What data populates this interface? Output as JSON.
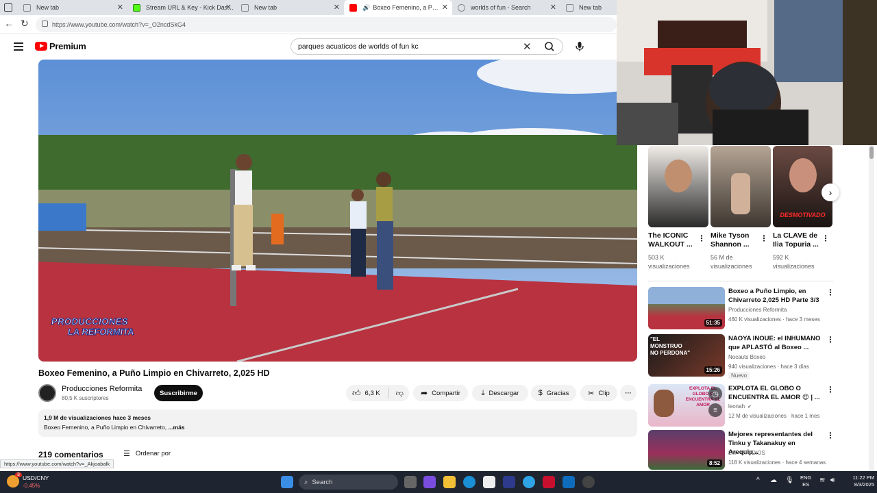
{
  "browser": {
    "tabs": [
      {
        "label": "New tab"
      },
      {
        "label": "Stream URL & Key - Kick Dashbo..."
      },
      {
        "label": "New tab"
      },
      {
        "label": "Boxeo Femenino, a Puño Lir..."
      },
      {
        "label": "worlds of fun - Search"
      },
      {
        "label": "New tab"
      }
    ],
    "url": "https://www.youtube.com/watch?v=_O2ncdSkG4",
    "status_url": "https://www.youtube.com/watch?v=_Akjoabalk"
  },
  "youtube": {
    "logo_text": "Premium",
    "search_value": "parques acuaticos de worlds of fun kc"
  },
  "video": {
    "title": "Boxeo Femenino, a Puño Limpio en Chivarreto, 2,025 HD",
    "watermark_line1": "PRODUCCIONES",
    "watermark_line2": "LA REFORMITA",
    "channel_name": "Producciones  Reformita",
    "subscribers": "80,5 K suscriptores",
    "subscribe_label": "Suscribirme",
    "likes": "6,3 K",
    "share_label": "Compartir",
    "download_label": "Descargar",
    "thanks_label": "Gracias",
    "clip_label": "Clip",
    "views_line": "1,9 M de visualizaciones  hace 3 meses",
    "description": "Boxeo Femenino, a Puño Limpio en Chivarreto, ",
    "more_label": "...más",
    "comments_count": "219 comentarios",
    "sort_label": "Ordenar por"
  },
  "shorts": [
    {
      "title": "The ICONIC WALKOUT ...",
      "views": "503 K visualizaciones"
    },
    {
      "title": "Mike Tyson Shannon ...",
      "views": "56 M de visualizaciones"
    },
    {
      "title": "La CLAVE de Ilia Topuria ...",
      "views": "592 K visualizaciones",
      "overlay": "DESMOTIVADO"
    }
  ],
  "recommended": [
    {
      "title": "Boxeo a Puño Limpio, en Chivarreto 2,025 HD Parte 3/3",
      "channel": "Producciones Reformita",
      "meta": "460 K visualizaciones · hace 3 meses",
      "duration": "51:35",
      "badge": ""
    },
    {
      "title": "NAOYA INOUE: el INHUMANO que APLASTÓ al Boxeo ...",
      "channel": "Nocauts Boxeo",
      "meta": "940 visualizaciones · hace 3 días",
      "duration": "15:26",
      "badge": "Nuevo",
      "thumb_text": "\"EL MONSTRUO NO PERDONA\""
    },
    {
      "title": "EXPLOTA EL GLOBO O ENCUENTRA EL AMOR 😍 | ...",
      "channel": "leonah",
      "meta": "12 M de visualizaciones · hace 1 mes",
      "duration": "",
      "badge": "",
      "thumb_text": "EXPLOTA EL GLOBO O ENCUENTRA EL AMOR"
    },
    {
      "title": "Mejores representantes del Tinku y Takanakuy en Arequip...",
      "channel": "LM - STUDIOS",
      "meta": "118 K visualizaciones · hace 4 semanas",
      "duration": "8:52",
      "badge": ""
    }
  ],
  "taskbar": {
    "ticker_name": "USD/CNY",
    "ticker_change": "-0.45%",
    "notification_count": "3",
    "search_placeholder": "Search",
    "lang_top": "ENG",
    "lang_bottom": "ES",
    "time": "11:22 PM",
    "date": "8/3/2025"
  },
  "colors": {
    "youtube_red": "#ff0000",
    "ring_floor": "#b8323f",
    "taskbar_bg": "#1f2530",
    "ticker_negative": "#ff6b6b"
  }
}
